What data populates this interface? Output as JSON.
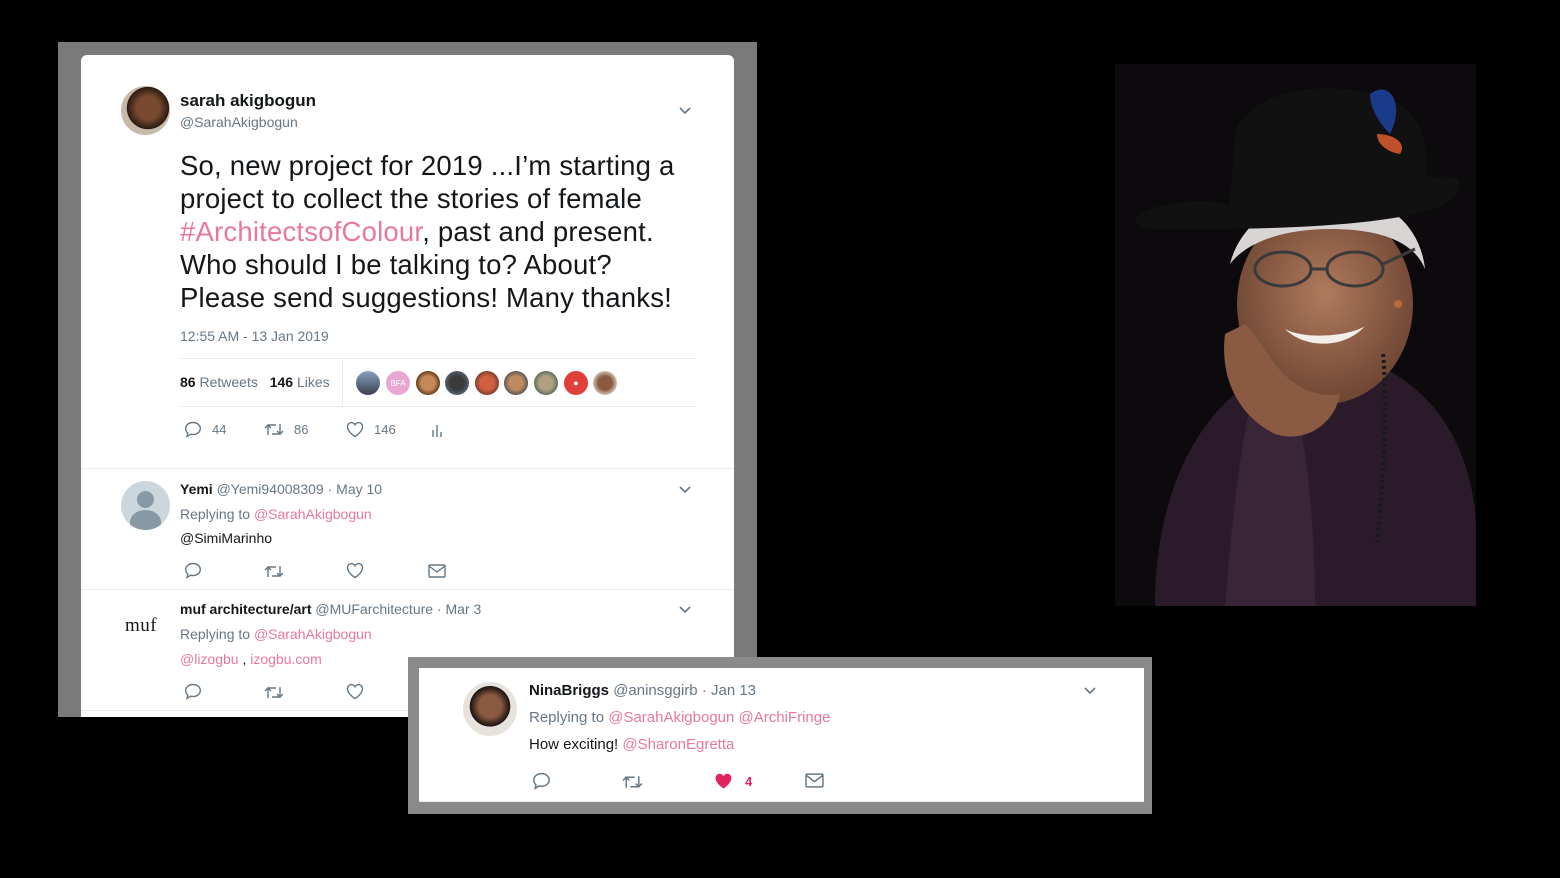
{
  "main_tweet": {
    "author_name": "sarah akigbogun",
    "author_handle": "@SarahAkigbogun",
    "text_1": "So, new project for 2019 ...I’m starting a project to collect the stories of female ",
    "hashtag": "#ArchitectsofColour",
    "text_2": ",  past and present. Who should I be talking to? About? Please send suggestions! Many thanks!",
    "timestamp": "12:55 AM - 13 Jan 2019",
    "retweets_count": "86",
    "retweets_label": "Retweets",
    "likes_count": "146",
    "likes_label": "Likes",
    "faces": [
      "",
      "BFA",
      "",
      "",
      "",
      "",
      "",
      "●",
      ""
    ],
    "actions": {
      "replies": "44",
      "retweets": "86",
      "likes": "146"
    }
  },
  "replies": [
    {
      "name": "Yemi",
      "handle": "@Yemi94008309",
      "date": "· May 10",
      "replying_label": "Replying to",
      "replying_to": "@SarahAkigbogun",
      "body": "@SimiMarinho"
    },
    {
      "name": "muf architecture/art",
      "handle": "@MUFarchitecture",
      "date": "· Mar 3",
      "avatar_text": "muf",
      "replying_label": "Replying to",
      "replying_to": "@SarahAkigbogun",
      "body_link_1": "@lizogbu",
      "body_sep": " , ",
      "body_link_2": "izogbu.com"
    }
  ],
  "nina_tweet": {
    "name": "NinaBriggs",
    "handle": "@aninsggirb",
    "date": "· Jan 13",
    "replying_label": "Replying to",
    "replying_to": "@SarahAkigbogun @ArchiFringe",
    "body_text": "How exciting! ",
    "body_link": "@SharonEgretta",
    "likes": "4"
  },
  "colors": {
    "link": "#e8779f",
    "like_active": "#e0245e",
    "muted": "#657786"
  }
}
